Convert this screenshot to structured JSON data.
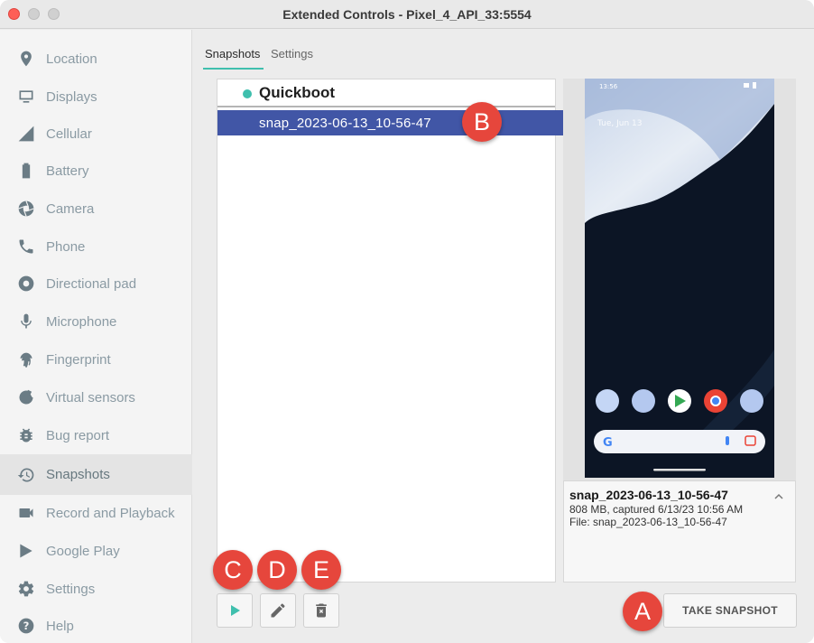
{
  "window": {
    "title": "Extended Controls - Pixel_4_API_33:5554"
  },
  "sidebar": {
    "items": [
      {
        "label": "Location",
        "icon": "location-pin-icon"
      },
      {
        "label": "Displays",
        "icon": "display-icon"
      },
      {
        "label": "Cellular",
        "icon": "signal-icon"
      },
      {
        "label": "Battery",
        "icon": "battery-icon"
      },
      {
        "label": "Camera",
        "icon": "camera-shutter-icon"
      },
      {
        "label": "Phone",
        "icon": "phone-icon"
      },
      {
        "label": "Directional pad",
        "icon": "dpad-icon"
      },
      {
        "label": "Microphone",
        "icon": "microphone-icon"
      },
      {
        "label": "Fingerprint",
        "icon": "fingerprint-icon"
      },
      {
        "label": "Virtual sensors",
        "icon": "rotate-sensor-icon"
      },
      {
        "label": "Bug report",
        "icon": "bug-icon"
      },
      {
        "label": "Snapshots",
        "icon": "history-icon",
        "active": true
      },
      {
        "label": "Record and Playback",
        "icon": "videocam-icon"
      },
      {
        "label": "Google Play",
        "icon": "play-store-icon"
      },
      {
        "label": "Settings",
        "icon": "gear-icon"
      },
      {
        "label": "Help",
        "icon": "help-icon"
      }
    ]
  },
  "tabs": [
    {
      "label": "Snapshots",
      "selected": true
    },
    {
      "label": "Settings",
      "selected": false
    }
  ],
  "snapshot_list": {
    "header": "Quickboot",
    "selected_item": "snap_2023-06-13_10-56-47"
  },
  "preview": {
    "phone_time": "13:56",
    "phone_date": "Tue, Jun 13"
  },
  "info": {
    "name": "snap_2023-06-13_10-56-47",
    "details": "808 MB, captured 6/13/23 10:56 AM",
    "file": "File: snap_2023-06-13_10-56-47"
  },
  "toolbar": {
    "play_icon": "play-icon",
    "edit_icon": "pencil-icon",
    "delete_icon": "trash-icon",
    "take_snapshot_label": "TAKE SNAPSHOT"
  },
  "callouts": {
    "a": "A",
    "b": "B",
    "c": "C",
    "d": "D",
    "e": "E"
  },
  "colors": {
    "accent": "#3fbfad",
    "selection": "#4156a6",
    "callout": "#e6463c"
  }
}
